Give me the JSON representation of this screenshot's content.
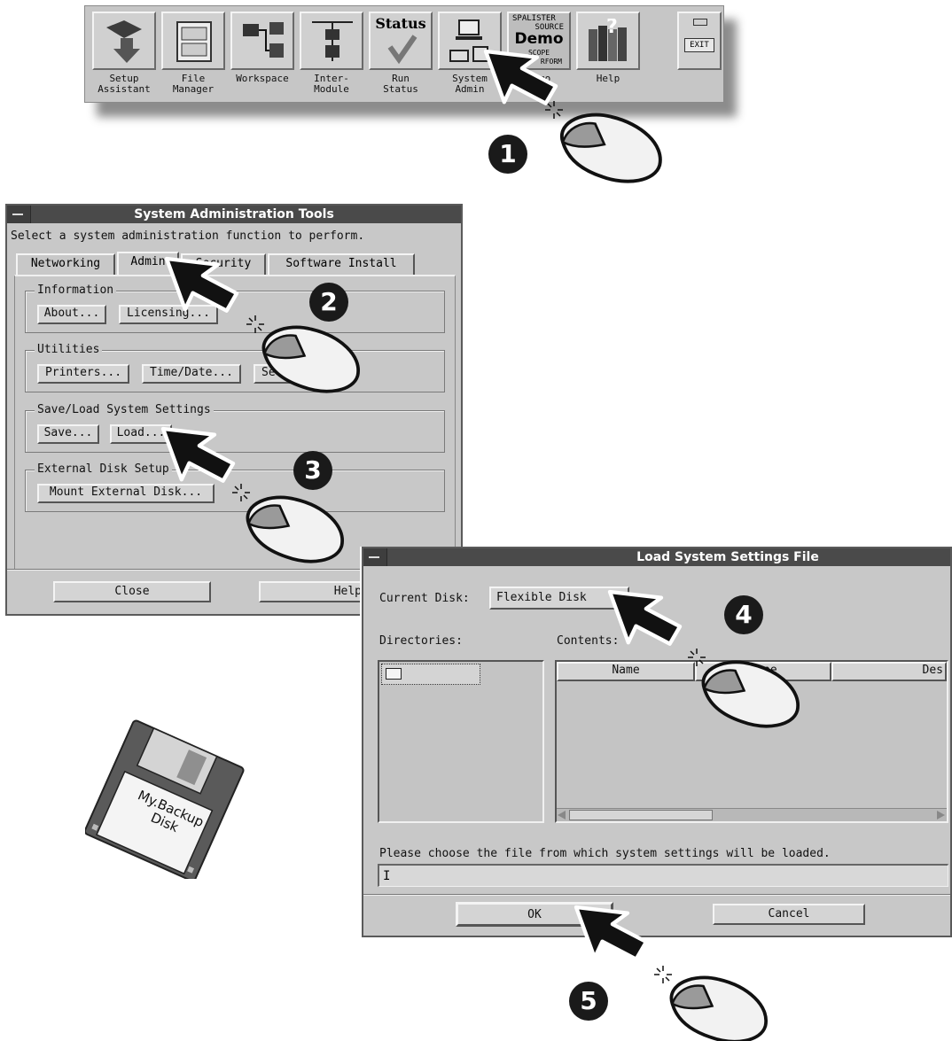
{
  "launcher": {
    "buttons": [
      {
        "label": "Setup\nAssistant"
      },
      {
        "label": "File\nManager"
      },
      {
        "label": "Workspace"
      },
      {
        "label": "Inter-\nModule"
      },
      {
        "label": "Run\nStatus",
        "icon_text": "Status"
      },
      {
        "label": "System\nAdmin"
      },
      {
        "label": "Demo\nLoader",
        "icon_lines": [
          "SPALISTER",
          "SOURCE",
          "Demo",
          "SCOPE",
          "RFORM"
        ]
      },
      {
        "label": "Help"
      },
      {
        "label": "",
        "icon_text": "EXIT"
      }
    ]
  },
  "admin_window": {
    "title": "System Administration Tools",
    "prompt": "Select a system administration function to perform.",
    "tabs": [
      "Networking",
      "Admin",
      "Security",
      "Software Install"
    ],
    "groups": {
      "information": {
        "title": "Information",
        "buttons": [
          "About...",
          "Licensing..."
        ]
      },
      "utilities": {
        "title": "Utilities",
        "buttons": [
          "Printers...",
          "Time/Date...",
          "Self-Test..."
        ]
      },
      "save_load": {
        "title": "Save/Load System Settings",
        "buttons": [
          "Save...",
          "Load..."
        ]
      },
      "external_disk": {
        "title": "External Disk Setup",
        "buttons": [
          "Mount External Disk..."
        ]
      }
    },
    "close_label": "Close",
    "help_label": "Help"
  },
  "load_window": {
    "title": "Load System Settings File",
    "current_disk_label": "Current Disk:",
    "current_disk_value": "Flexible Disk",
    "directories_label": "Directories:",
    "contents_label": "Contents:",
    "columns": [
      "Name",
      "Type",
      "Des"
    ],
    "prompt": "Please choose the file from which system settings will be loaded.",
    "filename_value": "",
    "ok_label": "OK",
    "cancel_label": "Cancel"
  },
  "floppy": {
    "label_line1": "My.Backup",
    "label_line2": "Disk"
  },
  "steps": [
    "1",
    "2",
    "3",
    "4",
    "5"
  ],
  "colors": {
    "titlebar": "#4a4a4a",
    "window": "#c8c8c8",
    "badge": "#1a1a1a"
  }
}
